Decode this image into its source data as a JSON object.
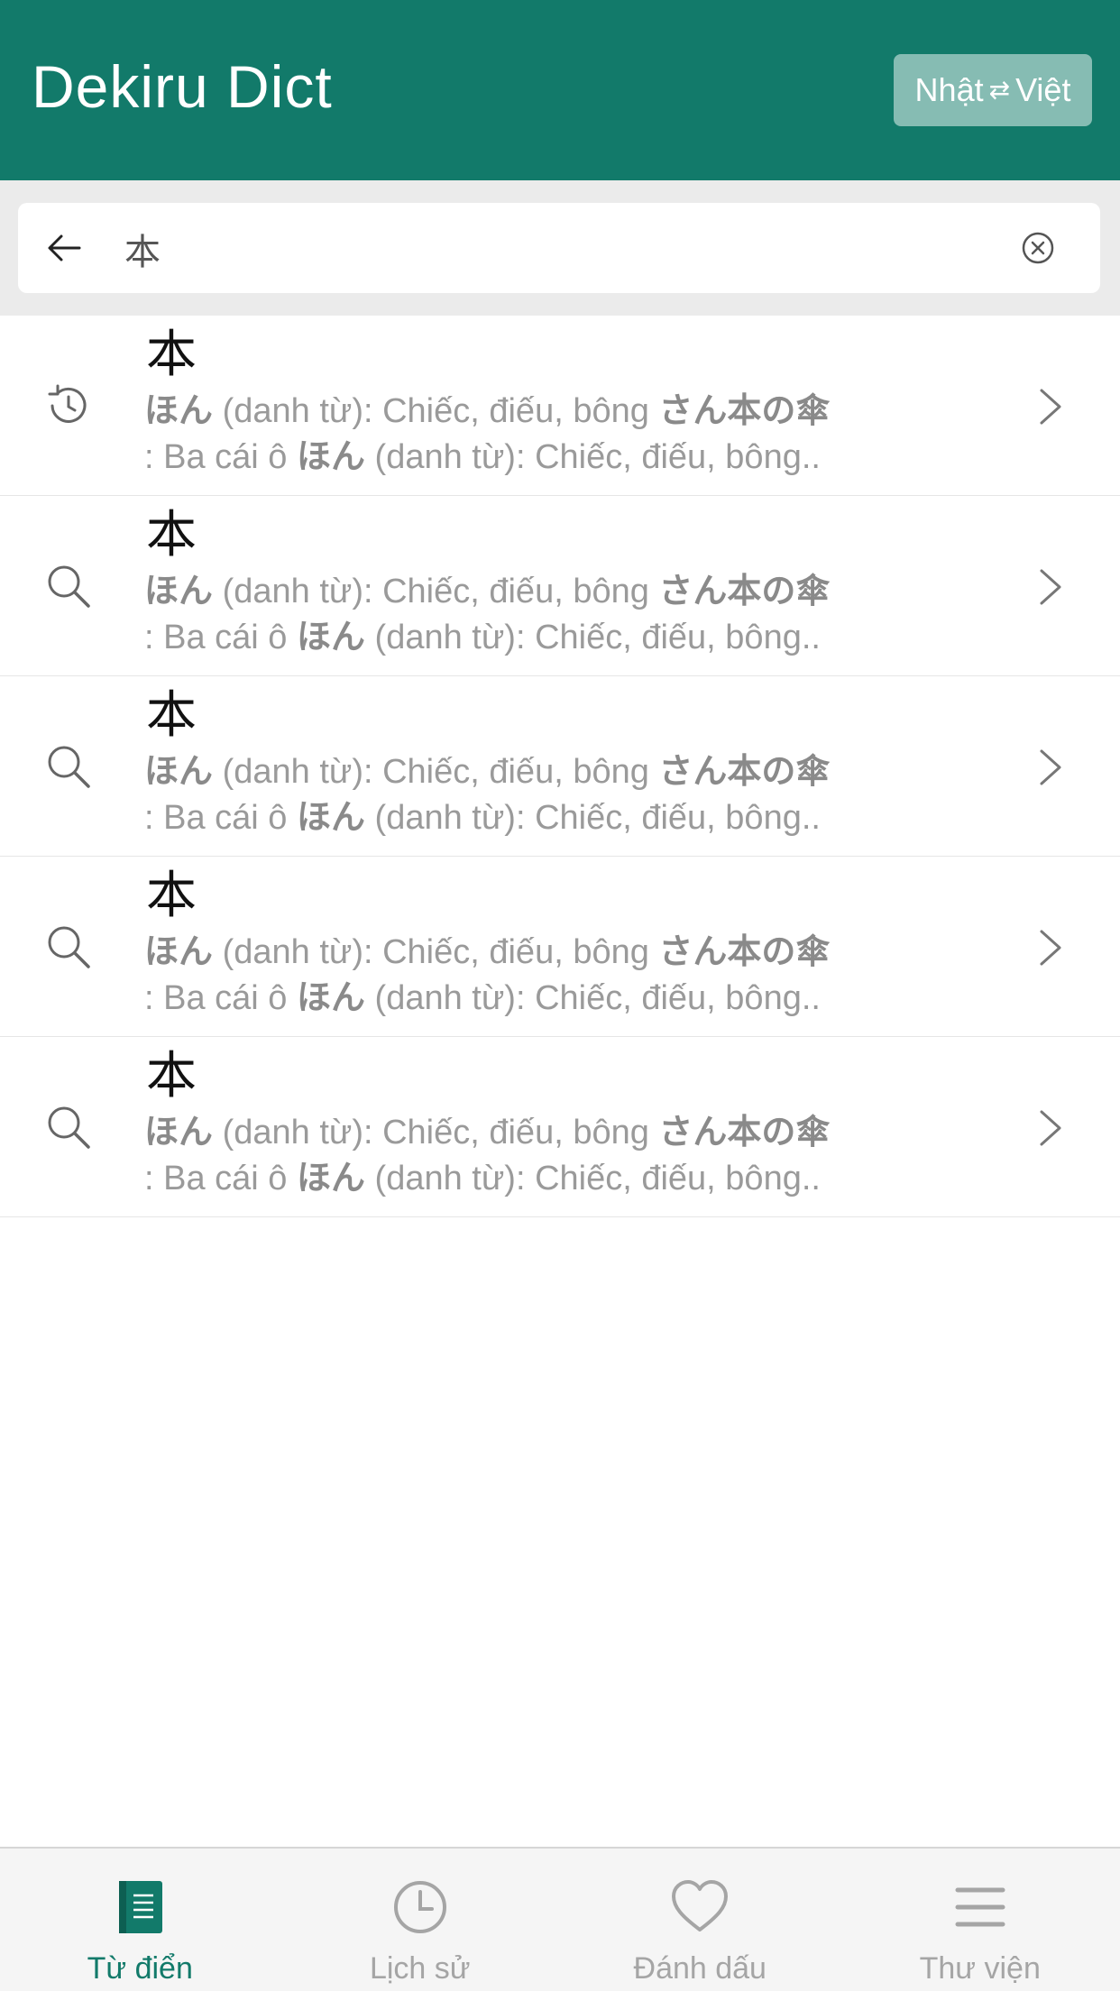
{
  "header": {
    "title": "Dekiru Dict",
    "lang_from": "Nhật",
    "swap_glyph": "⇄",
    "lang_to": "Việt"
  },
  "search": {
    "query": "本",
    "back_icon": "arrow-left-icon",
    "clear_icon": "clear-circle-icon"
  },
  "results": [
    {
      "icon": "history-icon",
      "word": "本",
      "reading1": "ほん",
      "text1": " (danh từ): Chiếc, điếu, bông ",
      "example": "さん本の傘",
      "line2_prefix": ": Ba cái ô ",
      "reading2": "ほん",
      "text2": " (danh từ): Chiếc, điếu, bông.."
    },
    {
      "icon": "search-icon",
      "word": "本",
      "reading1": "ほん",
      "text1": " (danh từ): Chiếc, điếu, bông ",
      "example": "さん本の傘",
      "line2_prefix": ": Ba cái ô ",
      "reading2": "ほん",
      "text2": " (danh từ): Chiếc, điếu, bông.."
    },
    {
      "icon": "search-icon",
      "word": "本",
      "reading1": "ほん",
      "text1": " (danh từ): Chiếc, điếu, bông ",
      "example": "さん本の傘",
      "line2_prefix": ": Ba cái ô ",
      "reading2": "ほん",
      "text2": " (danh từ): Chiếc, điếu, bông.."
    },
    {
      "icon": "search-icon",
      "word": "本",
      "reading1": "ほん",
      "text1": " (danh từ): Chiếc, điếu, bông ",
      "example": "さん本の傘",
      "line2_prefix": ": Ba cái ô ",
      "reading2": "ほん",
      "text2": " (danh từ): Chiếc, điếu, bông.."
    },
    {
      "icon": "search-icon",
      "word": "本",
      "reading1": "ほん",
      "text1": " (danh từ): Chiếc, điếu, bông ",
      "example": "さん本の傘",
      "line2_prefix": ": Ba cái ô ",
      "reading2": "ほん",
      "text2": " (danh từ): Chiếc, điếu, bông.."
    }
  ],
  "tabs": [
    {
      "label": "Từ điển",
      "icon": "book-icon",
      "active": true
    },
    {
      "label": "Lịch sử",
      "icon": "clock-icon",
      "active": false
    },
    {
      "label": "Đánh dấu",
      "icon": "heart-icon",
      "active": false
    },
    {
      "label": "Thư viện",
      "icon": "menu-icon",
      "active": false
    }
  ],
  "colors": {
    "brand": "#127a6a",
    "toggle_bg": "#86bcb3",
    "muted_text": "#9a9a9a",
    "inactive_tab": "#a5a5a5"
  }
}
